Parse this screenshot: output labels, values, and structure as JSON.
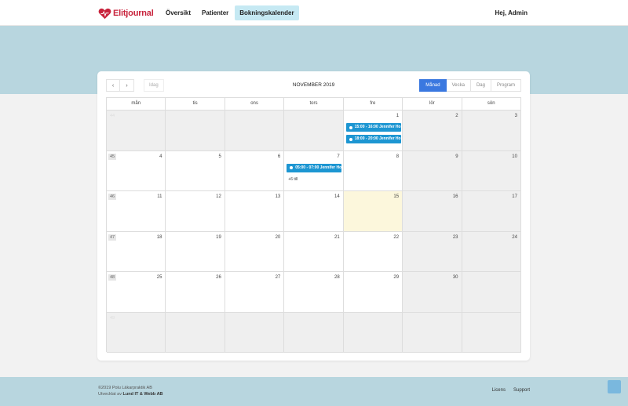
{
  "brand": {
    "name": "Elitjournal",
    "logo": "heart-logo-icon",
    "color": "#c8233c"
  },
  "nav": {
    "items": [
      "Översikt",
      "Patienter",
      "Bokningskalender"
    ],
    "active": 2
  },
  "greeting": "Hej, Admin",
  "calendar": {
    "prev_icon": "‹",
    "next_icon": "›",
    "today_label": "Idag",
    "title": "NOVEMBER 2019",
    "views": [
      "Månad",
      "Vecka",
      "Dag",
      "Program"
    ],
    "active_view": 0,
    "weekdays": [
      "mån",
      "tis",
      "ons",
      "tors",
      "fre",
      "lör",
      "sön"
    ],
    "weeks": [
      {
        "week": "44",
        "days": [
          "",
          "",
          "",
          "",
          "1",
          "2",
          "3"
        ]
      },
      {
        "week": "45",
        "days": [
          "4",
          "5",
          "6",
          "7",
          "8",
          "9",
          "10"
        ]
      },
      {
        "week": "46",
        "days": [
          "11",
          "12",
          "13",
          "14",
          "15",
          "16",
          "17"
        ]
      },
      {
        "week": "47",
        "days": [
          "18",
          "19",
          "20",
          "21",
          "22",
          "23",
          "24"
        ]
      },
      {
        "week": "48",
        "days": [
          "25",
          "26",
          "27",
          "28",
          "29",
          "30",
          ""
        ]
      },
      {
        "week": "49",
        "days": [
          "",
          "",
          "",
          "",
          "",
          "",
          ""
        ]
      }
    ],
    "events": {
      "fri1_a": "15:00 - 16:00 Jennifer Ho",
      "fri1_b": "18:00 - 20:00 Jennifer Ho",
      "thu7_a": "05:00 - 07:00 Jennifer Ho",
      "thu7_more": "+6 till"
    },
    "event_color": "#1d96d2",
    "today_color": "#fcf7dc",
    "accent": "#3a78e0"
  },
  "footer": {
    "copyright": "©2019 Polu Läkarpraktik AB",
    "developed_prefix": "Utvecklat av",
    "developer": "Lund IT & Webb AB",
    "links": [
      "Licens",
      "Support"
    ]
  }
}
